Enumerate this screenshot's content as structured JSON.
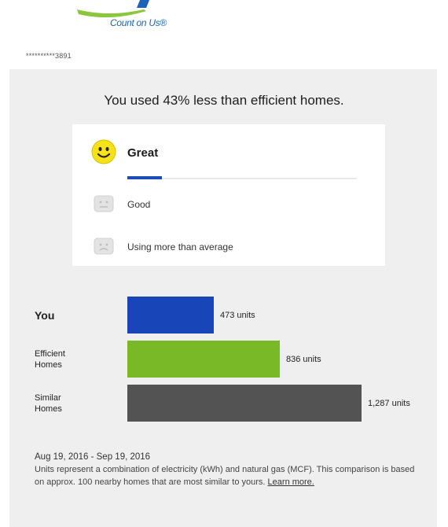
{
  "header": {
    "logo_text": "Count on Us®",
    "account_masked": "**********3891"
  },
  "headline": "You used 43% less than efficient homes.",
  "ranking": {
    "items": [
      {
        "label": "Great",
        "icon": "smiley-face-icon",
        "selected": true
      },
      {
        "label": "Good",
        "icon": "neutral-face-icon",
        "selected": false
      },
      {
        "label": "Using more than average",
        "icon": "frown-face-icon",
        "selected": false
      }
    ]
  },
  "chart_data": {
    "type": "bar",
    "orientation": "horizontal",
    "categories": [
      "You",
      "Efficient Homes",
      "Similar Homes"
    ],
    "values": [
      473,
      836,
      1287
    ],
    "value_labels": [
      "473 units",
      "836 units",
      "1,287 units"
    ],
    "colors": [
      "#1846b8",
      "#79b928",
      "#535353"
    ],
    "xlim": [
      0,
      1287
    ]
  },
  "footer": {
    "date_range": "Aug 19, 2016 - Sep 19, 2016",
    "note": "Units represent a combination of electricity (kWh) and natural gas (MCF). This comparison is based on approx. 100 nearby homes that are most similar to yours.",
    "learn_more": "Learn more."
  }
}
